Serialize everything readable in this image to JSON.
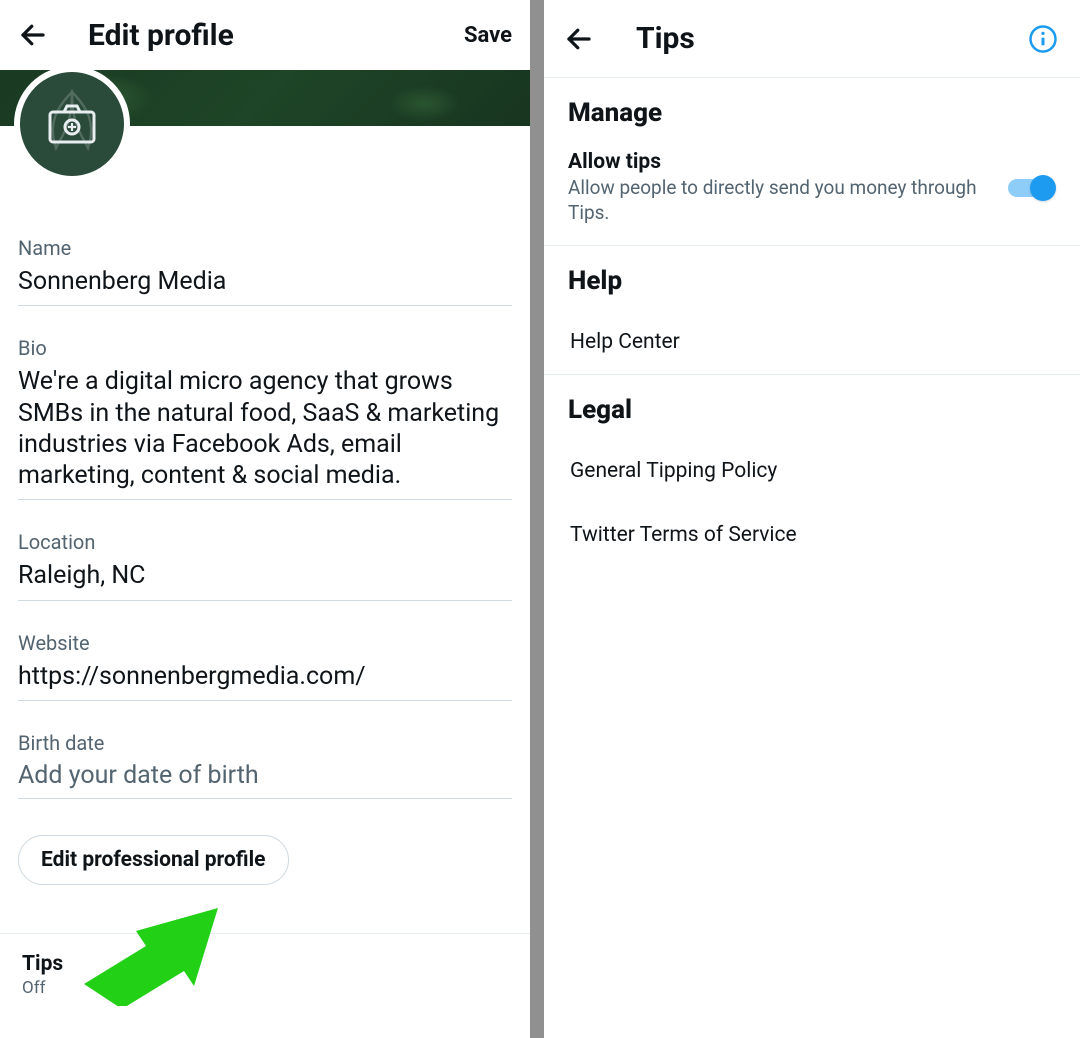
{
  "left": {
    "title": "Edit profile",
    "save": "Save",
    "fields": {
      "name": {
        "label": "Name",
        "value": "Sonnenberg Media"
      },
      "bio": {
        "label": "Bio",
        "value": "We're a digital micro agency that grows SMBs in the natural food, SaaS & marketing industries via Facebook Ads, email marketing, content & social media."
      },
      "location": {
        "label": "Location",
        "value": "Raleigh, NC"
      },
      "website": {
        "label": "Website",
        "value": "https://sonnenbergmedia.com/"
      },
      "birth": {
        "label": "Birth date",
        "placeholder": "Add your date of birth"
      }
    },
    "edit_professional": "Edit professional profile",
    "tips": {
      "label": "Tips",
      "status": "Off"
    }
  },
  "right": {
    "title": "Tips",
    "sections": {
      "manage": "Manage",
      "help": "Help",
      "legal": "Legal"
    },
    "allow_tips": {
      "title": "Allow tips",
      "desc": "Allow people to directly send you money through Tips.",
      "on": true
    },
    "links": {
      "help_center": "Help Center",
      "general_policy": "General Tipping Policy",
      "tos": "Twitter Terms of Service"
    }
  },
  "colors": {
    "accent": "#1d9bf0",
    "annotation": "#22d016"
  }
}
